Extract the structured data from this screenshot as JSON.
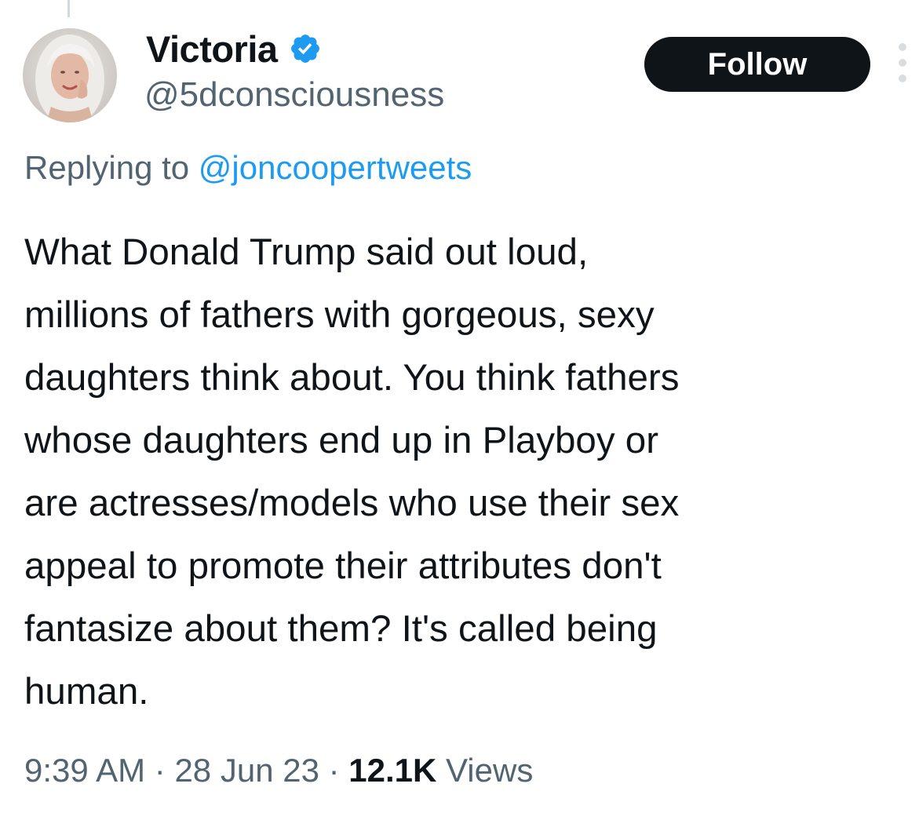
{
  "author": {
    "display_name": "Victoria",
    "handle": "@5dconsciousness",
    "verified": true,
    "verified_icon": "verified-badge-icon",
    "verified_color": "#1d9bf0",
    "avatar": "profile-photo"
  },
  "follow_label": "Follow",
  "more_icon": "more-vertical-icon",
  "reply": {
    "prefix": "Replying to",
    "mention": "@joncoopertweets"
  },
  "text_lines": [
    "What Donald Trump said out loud,",
    "millions of fathers with gorgeous, sexy",
    "daughters think about. You think fathers",
    "whose daughters end up in Playboy or",
    "are actresses/models who use their sex",
    "appeal to promote their attributes don't",
    "fantasize about them? It's called being",
    "human."
  ],
  "meta": {
    "time": "9:39 AM",
    "date": "28 Jun 23",
    "views_count": "12.1K",
    "views_label": "Views",
    "separator": "·"
  },
  "colors": {
    "text": "#0f1419",
    "secondary": "#536471",
    "link": "#1d9bf0",
    "button_bg": "#0f1419"
  }
}
